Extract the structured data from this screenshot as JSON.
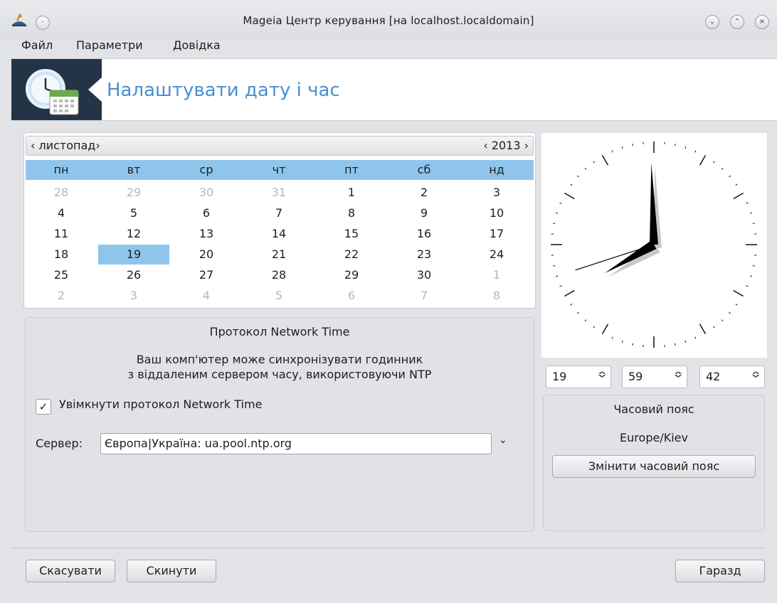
{
  "window": {
    "title": "Mageia Центр керування  [на localhost.localdomain]"
  },
  "menu": {
    "items": [
      "Файл",
      "Параметри",
      "Довідка"
    ]
  },
  "header": {
    "title": "Налаштувати дату і час"
  },
  "calendar": {
    "month": "‹ листопад›",
    "year": "‹ 2013 ›",
    "weekdays": [
      "пн",
      "вт",
      "ср",
      "чт",
      "пт",
      "сб",
      "нд"
    ],
    "rows": [
      [
        "28",
        "29",
        "30",
        "31",
        "1",
        "2",
        "3"
      ],
      [
        "4",
        "5",
        "6",
        "7",
        "8",
        "9",
        "10"
      ],
      [
        "11",
        "12",
        "13",
        "14",
        "15",
        "16",
        "17"
      ],
      [
        "18",
        "19",
        "20",
        "21",
        "22",
        "23",
        "24"
      ],
      [
        "25",
        "26",
        "27",
        "28",
        "29",
        "30",
        "1"
      ],
      [
        "2",
        "3",
        "4",
        "5",
        "6",
        "7",
        "8"
      ]
    ],
    "selected": "19"
  },
  "time": {
    "hour": "19",
    "minute": "59",
    "second": "42",
    "spin_arrow": "≎"
  },
  "ntp": {
    "title": "Протокол Network Time",
    "desc_line1": "Ваш комп'ютер може синхронізувати годинник",
    "desc_line2": "з віддаленим сервером часу, використовуючи NTP",
    "enable_label": "Увімкнути протокол Network Time",
    "enabled_mark": "✓",
    "server_label": "Сервер:",
    "server_value": "Європа|Україна: ua.pool.ntp.org",
    "dropdown_glyph": "⌄"
  },
  "timezone": {
    "title": "Часовий пояс",
    "value": "Europe/Kiev",
    "change_button": "Змінити часовий пояс"
  },
  "buttons": {
    "cancel": "Скасувати",
    "reset": "Скинути",
    "ok": "Гаразд"
  },
  "titlebar_buttons": {
    "minimize": "⌄",
    "maximize": "⌃",
    "close": "×"
  }
}
